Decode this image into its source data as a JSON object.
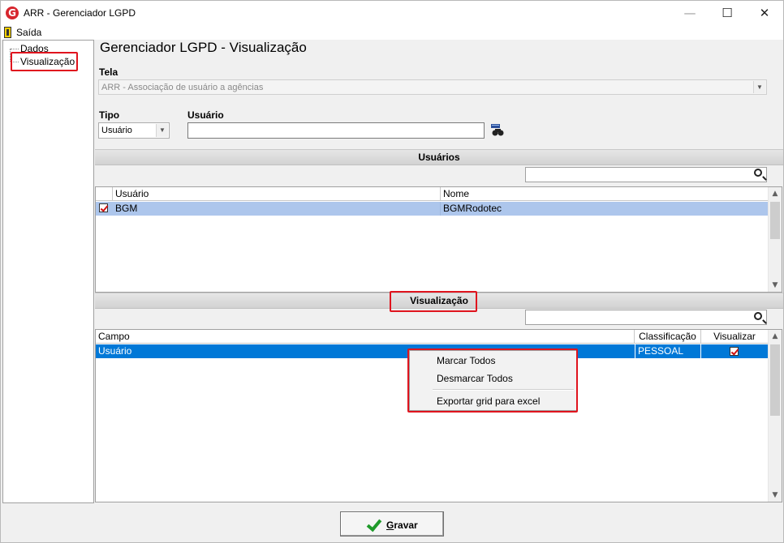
{
  "window": {
    "title": "ARR - Gerenciador LGPD",
    "logo_letter": "G",
    "minimize": "—",
    "maximize": "☐",
    "close": "✕"
  },
  "menubar": {
    "exit_label": "Saída"
  },
  "tree": {
    "items": [
      {
        "label": "Dados"
      },
      {
        "label": "Visualização"
      }
    ]
  },
  "main": {
    "title": "Gerenciador LGPD - Visualização",
    "tela_label": "Tela",
    "tela_value": "ARR - Associação de usuário a agências",
    "tipo_label": "Tipo",
    "tipo_value": "Usuário",
    "usuario_label": "Usuário",
    "usuario_value": ""
  },
  "users_section": {
    "title": "Usuários",
    "search_value": "",
    "columns": [
      "Usuário",
      "Nome"
    ],
    "rows": [
      {
        "checked": true,
        "usuario": "BGM",
        "nome": "BGMRodotec"
      }
    ]
  },
  "visualizacao_section": {
    "title": "Visualização",
    "search_value": "",
    "columns": [
      "Campo",
      "Classificação",
      "Visualizar"
    ],
    "rows": [
      {
        "campo": "Usuário",
        "classificacao": "PESSOAL",
        "visualizar": true
      }
    ]
  },
  "context_menu": {
    "items": [
      "Marcar Todos",
      "Desmarcar Todos",
      "Exportar grid para excel"
    ]
  },
  "footer": {
    "save_label": "Gravar",
    "save_mnemonic": "G",
    "save_rest": "ravar"
  },
  "colors": {
    "highlight_red": "#e0141e",
    "selected_row": "#adc6ec",
    "active_row": "#0078d7",
    "save_check": "#1f9a2a"
  }
}
